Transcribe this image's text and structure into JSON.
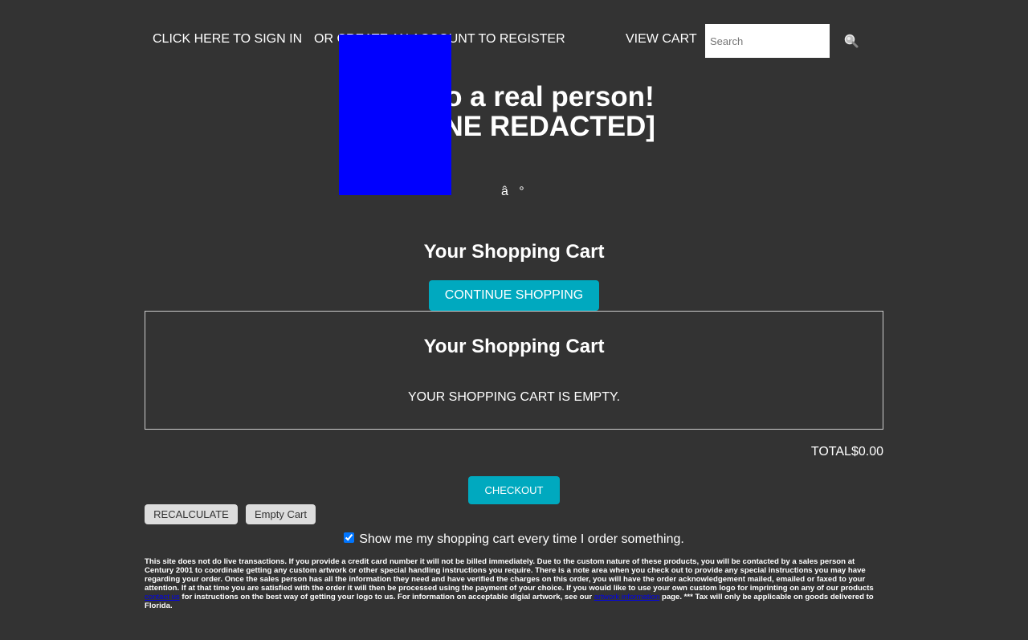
{
  "topbar": {
    "signin_label": "CLICK HERE TO SIGN IN",
    "create_label": "OR CREATE AN ACCOUNT TO REGISTER",
    "viewcart_label": "VIEW CART",
    "search_placeholder": "Search",
    "search_icon": "search-icon"
  },
  "header": {
    "line1": "Talk to a real person!",
    "line2": "[PHONE REDACTED]",
    "glyphs": "â   °"
  },
  "cart": {
    "title": "Your Shopping Cart",
    "continue_label": "CONTINUE SHOPPING",
    "box_title": "Your Shopping Cart",
    "empty_message": "YOUR SHOPPING CART IS EMPTY.",
    "total_label": "TOTAL",
    "total_value": "$0.00",
    "checkout_label": "CHECKOUT",
    "recalculate_label": "RECALCULATE",
    "empty_cart_label": "Empty Cart",
    "show_cart_label": "Show me my shopping cart every time I order something.",
    "show_cart_checked": true
  },
  "disclaimer": {
    "part1": "This site does not do live transactions. If you provide a credit card number it will not be billed immediately. Due to the custom nature of these products, you will be contacted by a sales person at Century 2001 to coordinate getting any custom artwork or other special handling instructions you require. There is a note area when you check out to provide any special instructions you may have regarding your order. Once the sales person has all the information they need and have verified the charges on this order, you will have the order acknowledgement mailed, emailed or faxed to your attention. If at that time you are satisfied with the order it will then be processed using the payment of your choice. If you would like to use your own custom logo for imprinting on any of our products ",
    "link1": "contact us",
    "part2": " for instructions on the best way of getting your logo to us. For information on acceptable digial artwork, see our ",
    "link2": "artwork information",
    "part3": " page. *** Tax will only be applicable on goods delivered to Florida."
  },
  "colors": {
    "background": "#333333",
    "accent": "#00a9bf",
    "overlay_block": "#0000ff"
  }
}
